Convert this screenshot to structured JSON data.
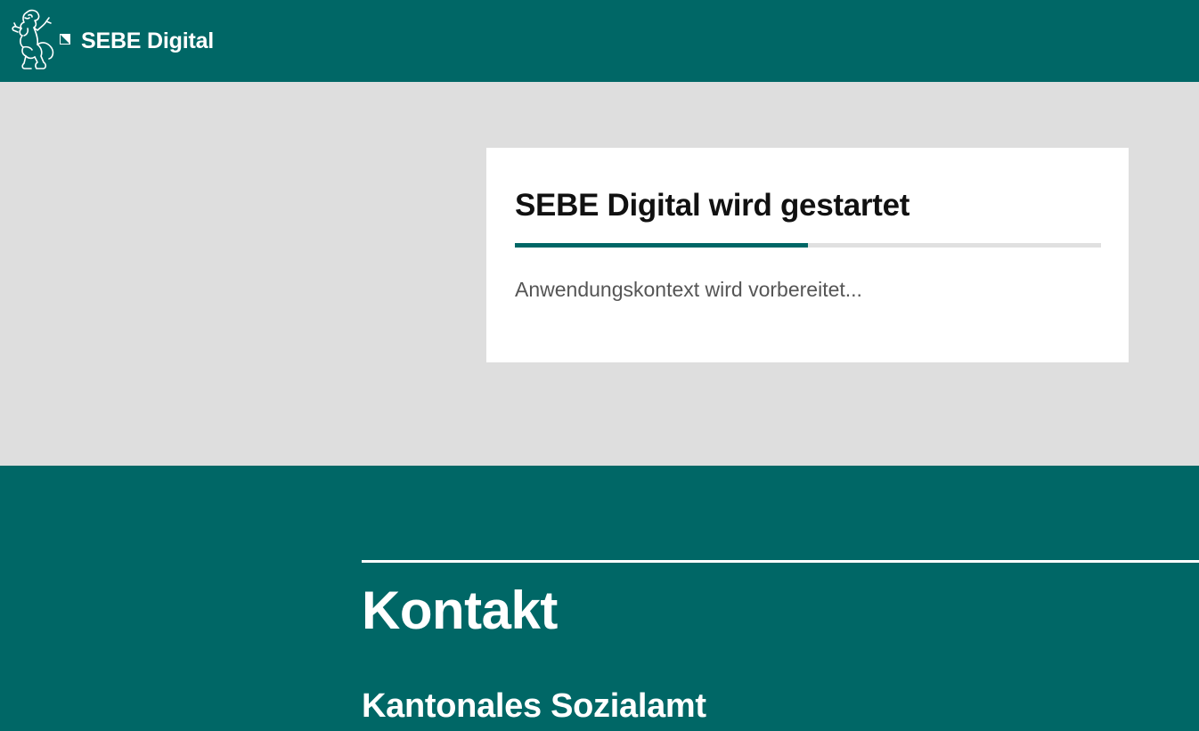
{
  "header": {
    "app_name": "SEBE Digital",
    "logo_icon": "bern-lion-icon",
    "brand_color": "#006766"
  },
  "loader": {
    "title": "SEBE Digital wird gestartet",
    "progress": 0.5,
    "status": "Anwendungskontext wird vorbereitet..."
  },
  "footer": {
    "heading": "Kontakt",
    "subheading": "Kantonales Sozialamt"
  }
}
